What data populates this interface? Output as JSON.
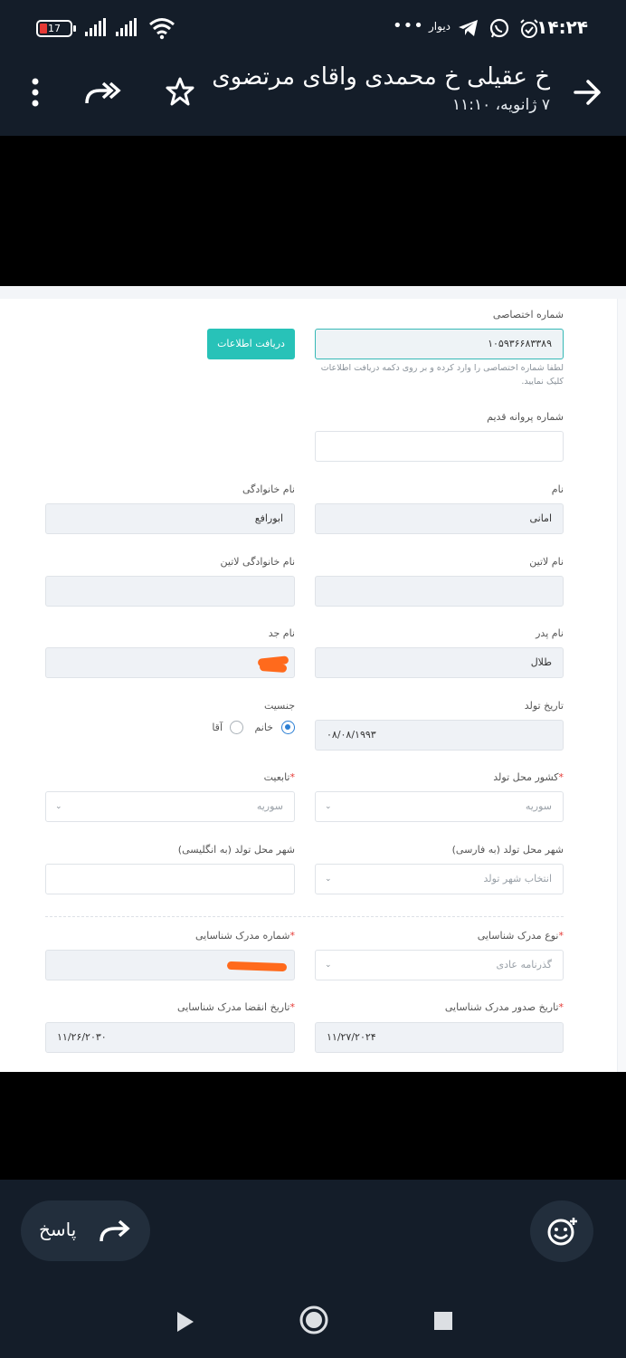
{
  "status_bar": {
    "time": "۱۴:۲۴",
    "battery": "17",
    "notification_text": "دیوار",
    "more_dots": "•••"
  },
  "header": {
    "title": "خ عقیلی خ محمدی واقای مرتضوی",
    "subtitle": "۷ ژانویه، ۱۱:۱۰"
  },
  "form": {
    "private_number": {
      "label": "شماره اختصاصی",
      "value": "۱۰۵۹۳۶۶۸۳۳۸۹"
    },
    "fetch_button": "دریافت اطلاعات",
    "hint": [
      "لطفا شماره اختصاصی را وارد کرده و بر روی دکمه دریافت اطلاعات",
      "کلیک نمایید."
    ],
    "old_license": {
      "label": "شماره پروانه قدیم",
      "value": ""
    },
    "first_name": {
      "label": "نام",
      "value": "امانی"
    },
    "last_name": {
      "label": "نام خانوادگی",
      "value": "ابورافع"
    },
    "latin_name": {
      "label": "نام لاتین",
      "value": ""
    },
    "latin_last_name": {
      "label": "نام خانوادگی لاتین",
      "value": ""
    },
    "father_name": {
      "label": "نام پدر",
      "value": "طلال"
    },
    "grandfather_name": {
      "label": "نام جد",
      "value": ""
    },
    "birth_date": {
      "label": "تاریخ تولد",
      "value": "۰۸/۰۸/۱۹۹۳"
    },
    "gender": {
      "label": "جنسیت",
      "options": [
        "خانم",
        "آقا"
      ],
      "selected": "خانم"
    },
    "birth_country": {
      "label": "کشور محل تولد",
      "value": "سوریه"
    },
    "nationality": {
      "label": "تابعیت",
      "value": "سوریه"
    },
    "birth_city_fa": {
      "label": "شهر محل تولد (به فارسی)",
      "placeholder": "انتخاب شهر تولد"
    },
    "birth_city_en": {
      "label": "شهر محل تولد (به انگلیسی)",
      "value": ""
    },
    "id_doc_type": {
      "label": "نوع مدرک شناسایی",
      "value": "گذرنامه عادی"
    },
    "id_doc_number": {
      "label": "شماره مدرک شناسایی",
      "value": ""
    },
    "id_issue_date": {
      "label": "تاریخ صدور مدرک شناسایی",
      "value": "۱۱/۲۷/۲۰۲۴"
    },
    "id_expiry_date": {
      "label": "تاریخ انقضا مدرک شناسایی",
      "value": "۱۱/۲۶/۲۰۳۰"
    },
    "required_mark": "*"
  },
  "actions": {
    "reply_label": "پاسخ"
  },
  "colors": {
    "chrome_bg": "#141d29",
    "accent": "#28c2b8",
    "required": "#e53935"
  }
}
